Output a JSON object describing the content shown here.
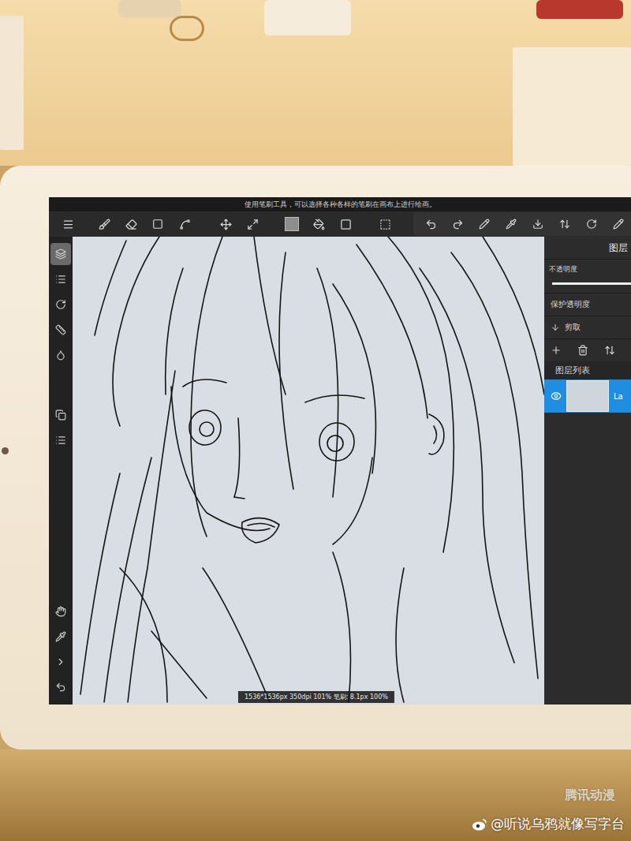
{
  "hint": "使用笔刷工具，可以选择各种各样的笔刷在画布上进行绘画。",
  "left_tools": [
    {
      "selected": true
    },
    {
      "selected": false
    },
    {
      "selected": false
    },
    {
      "selected": false
    },
    {
      "selected": false
    },
    {
      "selected": false
    },
    {
      "selected": false
    },
    {
      "selected": false
    },
    {
      "selected": false
    },
    {
      "selected": false
    },
    {
      "selected": false
    }
  ],
  "layer_panel": {
    "title": "图层",
    "opacity_label": "不透明度",
    "opacity_level": 1,
    "protect_alpha": "保护透明度",
    "clip": "剪取",
    "list_label": "图层列表",
    "layers": [
      {
        "name": "La",
        "visible": true,
        "selected": true
      }
    ]
  },
  "status": "1536*1536px 350dpi 101% 笔刷: 8.1px 100%",
  "watermark": "@听说乌鸦就像写字台",
  "logo": "腾讯动漫"
}
